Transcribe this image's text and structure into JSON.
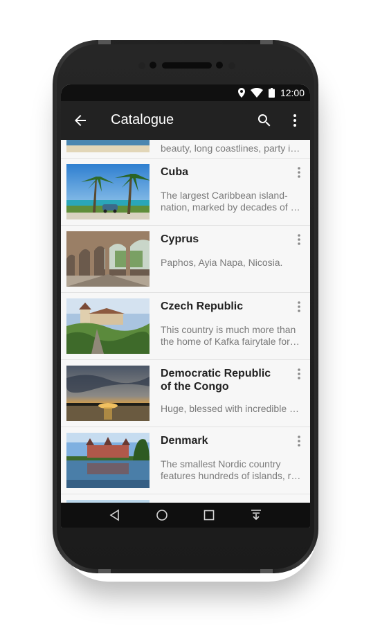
{
  "status": {
    "time": "12:00",
    "icons": [
      "location-icon",
      "wifi-icon",
      "battery-icon"
    ]
  },
  "appbar": {
    "title": "Catalogue",
    "back_icon": "arrow-left-icon",
    "search_icon": "search-icon",
    "more_icon": "more-vert-icon"
  },
  "list": {
    "partial_top_desc": "beauty, long coastlines, party isl…",
    "items": [
      {
        "name_lines": [
          "Cuba"
        ],
        "desc_lines": [
          "The largest Caribbean island-",
          "nation, marked by decades of s…"
        ]
      },
      {
        "name_lines": [
          "Cyprus"
        ],
        "desc_lines": [
          "Paphos, Ayia Napa, Nicosia."
        ]
      },
      {
        "name_lines": [
          "Czech Republic"
        ],
        "desc_lines": [
          "This country is much more than",
          "the home of Kafka fairytale fore…"
        ]
      },
      {
        "name_lines": [
          "Democratic Republic",
          "of the Congo"
        ],
        "desc_lines": [
          "Huge, blessed with incredible n…"
        ]
      },
      {
        "name_lines": [
          "Denmark"
        ],
        "desc_lines": [
          "The smallest Nordic country",
          "features hundreds of islands, ro…"
        ]
      }
    ]
  },
  "navbar": {
    "icons": [
      "back-triangle-icon",
      "home-circle-icon",
      "recents-square-icon",
      "hide-keyboard-icon"
    ]
  },
  "colors": {
    "appbar": "#222222",
    "statusbar": "#101010",
    "list_bg": "#f7f7f7",
    "title_text": "#222222",
    "desc_text": "#7a7a7a"
  }
}
